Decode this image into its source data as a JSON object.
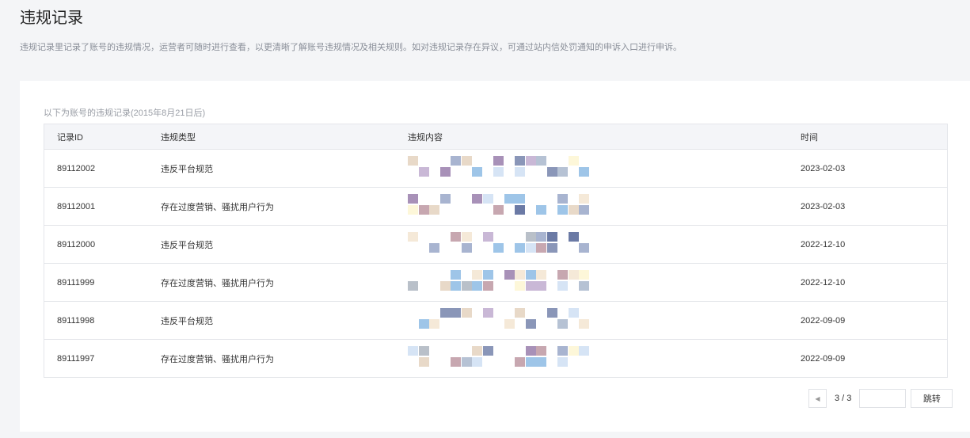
{
  "page": {
    "title": "违规记录",
    "description": "违规记录里记录了账号的违规情况，运营者可随时进行查看，以更清晰了解账号违规情况及相关规则。如对违规记录存在异议，可通过站内信处罚通知的申诉入口进行申诉。"
  },
  "table": {
    "caption": "以下为账号的违规记录(2015年8月21日后)",
    "headers": [
      "记录ID",
      "违规类型",
      "违规内容",
      "时间"
    ],
    "rows": [
      {
        "id": "89112002",
        "type": "违反平台规范",
        "time": "2023-02-03"
      },
      {
        "id": "89112001",
        "type": "存在过度营销、骚扰用户行为",
        "time": "2023-02-03"
      },
      {
        "id": "89112000",
        "type": "违反平台规范",
        "time": "2022-12-10"
      },
      {
        "id": "89111999",
        "type": "存在过度营销、骚扰用户行为",
        "time": "2022-12-10"
      },
      {
        "id": "89111998",
        "type": "违反平台规范",
        "time": "2022-09-09"
      },
      {
        "id": "89111997",
        "type": "存在过度营销、骚扰用户行为",
        "time": "2022-09-09"
      }
    ]
  },
  "pagination": {
    "prev_icon": "caret-left-icon",
    "current": "3 / 3",
    "jump_input": "",
    "jump_label": "跳转"
  }
}
